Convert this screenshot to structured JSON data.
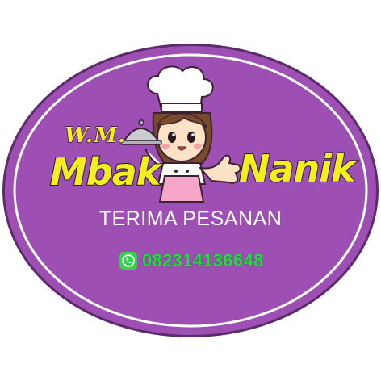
{
  "badge": {
    "prefix": "W.M.",
    "name_left": "Mbak",
    "name_right": "Nanik",
    "tagline": "TERIMA PESANAN",
    "phone": "082314136648",
    "icons": {
      "contact": "whatsapp-icon",
      "mascot": "chef-girl-illustration"
    },
    "colors": {
      "background": "#9d4fb4",
      "border": "#ffffff",
      "outline": "#5d2a6e",
      "title": "#f4ee1f",
      "phone": "#2fd34c"
    }
  }
}
